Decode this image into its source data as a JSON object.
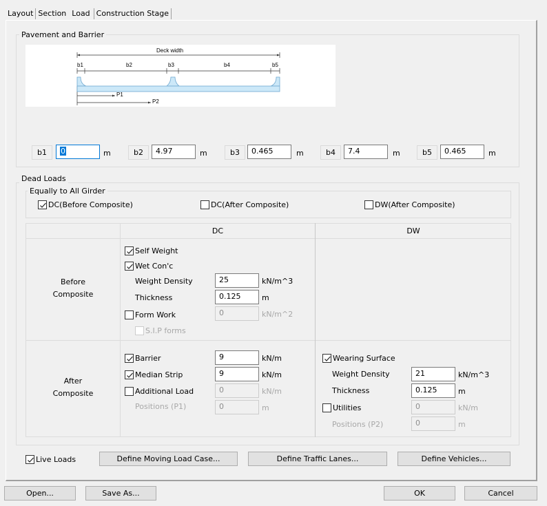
{
  "tabs": [
    {
      "label": "Layout",
      "active": false
    },
    {
      "label": "Section",
      "active": false
    },
    {
      "label": "Load",
      "active": true
    },
    {
      "label": "Construction Stage",
      "active": false
    }
  ],
  "pavement": {
    "title": "Pavement and Barrier",
    "diagram": {
      "deck_width_label": "Deck width",
      "segment_labels": [
        "b1",
        "b2",
        "b3",
        "b4",
        "b5"
      ],
      "position_labels": [
        "P1",
        "P2"
      ],
      "fill_color": "#cce8f8",
      "stroke_color": "#6fa8d0"
    },
    "fields": [
      {
        "label": "b1",
        "value": "0",
        "unit": "m",
        "focused": true
      },
      {
        "label": "b2",
        "value": "4.97",
        "unit": "m"
      },
      {
        "label": "b3",
        "value": "0.465",
        "unit": "m"
      },
      {
        "label": "b4",
        "value": "7.4",
        "unit": "m"
      },
      {
        "label": "b5",
        "value": "0.465",
        "unit": "m"
      }
    ]
  },
  "dead_loads": {
    "title": "Dead Loads",
    "equally": {
      "title": "Equally to All Girder",
      "options": [
        {
          "label": "DC(Before Composite)",
          "checked": true
        },
        {
          "label": "DC(After Composite)",
          "checked": false
        },
        {
          "label": "DW(After Composite)",
          "checked": false
        }
      ]
    },
    "table": {
      "col_headers": [
        "DC",
        "DW"
      ],
      "row_headers": {
        "before": [
          "Before",
          "Composite"
        ],
        "after": [
          "After",
          "Composite"
        ]
      },
      "before_dc": {
        "self_weight": {
          "label": "Self Weight",
          "checked": true
        },
        "wet_conc": {
          "label": "Wet Con'c",
          "checked": true
        },
        "weight_density": {
          "label": "Weight Density",
          "value": "25",
          "unit": "kN/m^3"
        },
        "thickness": {
          "label": "Thickness",
          "value": "0.125",
          "unit": "m"
        },
        "form_work": {
          "label": "Form Work",
          "checked": false,
          "value": "0",
          "unit": "kN/m^2"
        },
        "sip_forms": {
          "label": "S.I.P forms",
          "checked": false
        }
      },
      "after_dc": {
        "barrier": {
          "label": "Barrier",
          "checked": true,
          "value": "9",
          "unit": "kN/m"
        },
        "median": {
          "label": "Median Strip",
          "checked": true,
          "value": "9",
          "unit": "kN/m"
        },
        "additional": {
          "label": "Additional Load",
          "checked": false,
          "value": "0",
          "unit": "kN/m"
        },
        "positions": {
          "label": "Positions (P1)",
          "value": "0",
          "unit": "m"
        }
      },
      "after_dw": {
        "wearing": {
          "label": "Wearing Surface",
          "checked": true
        },
        "weight_density": {
          "label": "Weight Density",
          "value": "21",
          "unit": "kN/m^3"
        },
        "thickness": {
          "label": "Thickness",
          "value": "0.125",
          "unit": "m"
        },
        "utilities": {
          "label": "Utilities",
          "checked": false,
          "value": "0",
          "unit": "kN/m"
        },
        "positions": {
          "label": "Positions (P2)",
          "value": "0",
          "unit": "m"
        }
      }
    }
  },
  "live_loads": {
    "label": "Live Loads",
    "checked": true,
    "buttons": [
      "Define Moving Load Case...",
      "Define Traffic Lanes...",
      "Define Vehicles..."
    ]
  },
  "footer": {
    "open": "Open...",
    "save_as": "Save As...",
    "ok": "OK",
    "cancel": "Cancel"
  }
}
